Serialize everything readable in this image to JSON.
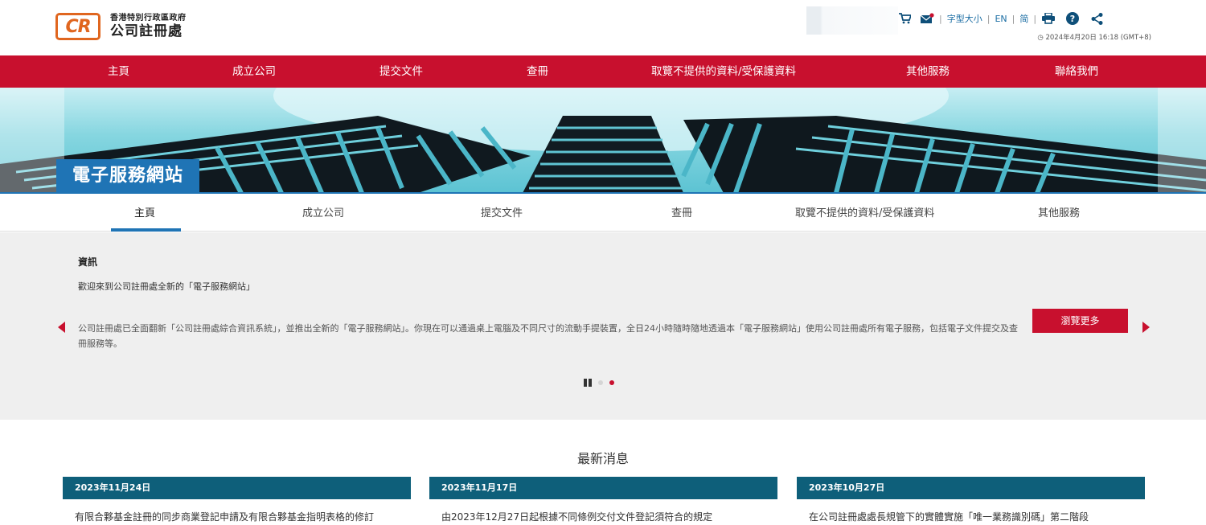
{
  "header": {
    "logo_badge": "CR",
    "logo_gov": "香港特別行政區政府",
    "logo_name": "公司註冊處",
    "font_size_label": "字型大小",
    "lang_en": "EN",
    "lang_sc": "简",
    "datetime": "2024年4月20日 16:18 (GMT+8)",
    "icons": [
      "cart-icon",
      "mail-icon",
      "print-icon",
      "help-icon",
      "share-icon"
    ]
  },
  "main_nav": [
    "主頁",
    "成立公司",
    "提交文件",
    "查冊",
    "取覽不提供的資料/受保護資料",
    "其他服務",
    "聯絡我們"
  ],
  "banner": {
    "title": "電子服務網站"
  },
  "sub_nav": {
    "items": [
      "主頁",
      "成立公司",
      "提交文件",
      "查冊",
      "取覽不提供的資料/受保護資料",
      "其他服務"
    ],
    "active": "主頁"
  },
  "info": {
    "title": "資訊",
    "welcome": "歡迎來到公司註冊處全新的「電子服務網站」",
    "body": "公司註冊處已全面翻新「公司註冊處綜合資訊系統」，並推出全新的「電子服務網站」。你現在可以通過桌上電腦及不同尺寸的流動手提裝置，全日24小時隨時隨地透過本「電子服務網站」使用公司註冊處所有電子服務，包括電子文件提交及查冊服務等。",
    "more_button": "瀏覽更多",
    "slide_count": 2,
    "active_slide": 2
  },
  "news": {
    "title": "最新消息",
    "items": [
      {
        "date": "2023年11月24日",
        "text": "有限合夥基金註冊的同步商業登記申請及有限合夥基金指明表格的修訂"
      },
      {
        "date": "2023年11月17日",
        "text": "由2023年12月27日起根據不同條例交付文件登記須符合的規定"
      },
      {
        "date": "2023年10月27日",
        "text": "在公司註冊處處長規管下的實體實施「唯一業務識別碼」第二階段"
      }
    ]
  },
  "colors": {
    "brand_red": "#c8102e",
    "brand_blue": "#1f74b5",
    "news_teal": "#0e5f7a",
    "logo_orange": "#e0661f"
  }
}
